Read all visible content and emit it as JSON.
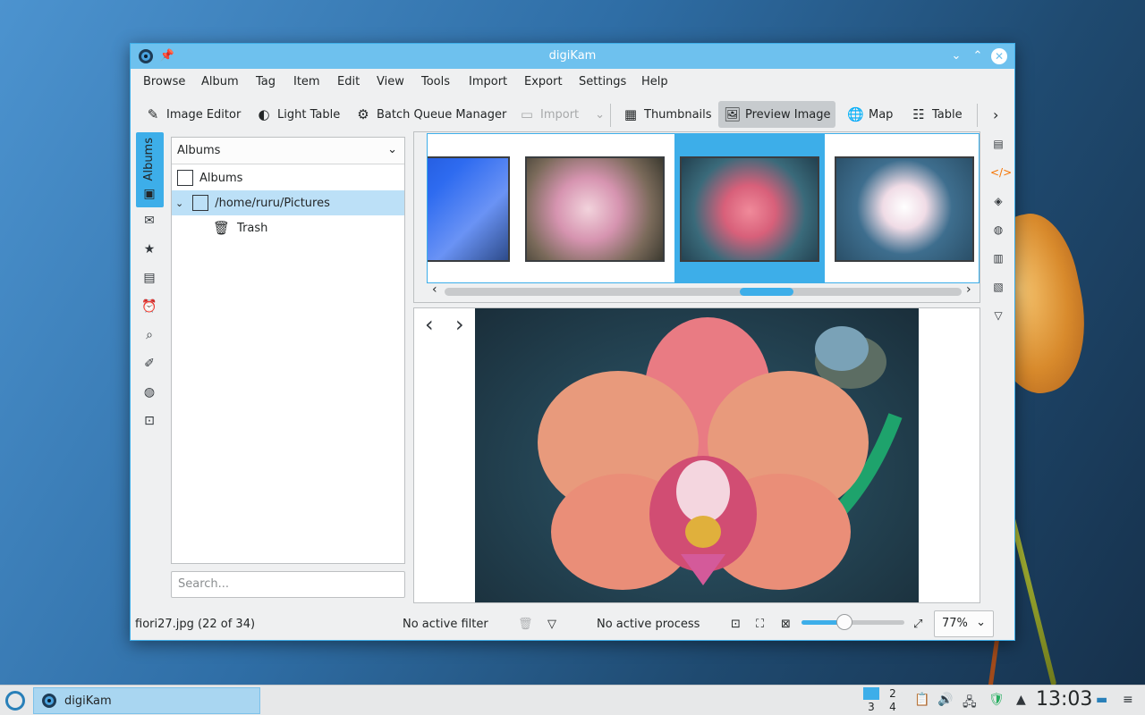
{
  "window": {
    "title": "digiKam",
    "minimize_icon": "chevron-down-icon",
    "maximize_icon": "chevron-up-icon",
    "close_icon": "close-icon"
  },
  "menubar": [
    "Browse",
    "Album",
    "Tag",
    "Item",
    "Edit",
    "View",
    "Tools",
    "Import",
    "Export",
    "Settings",
    "Help"
  ],
  "toolbar": {
    "image_editor": "Image Editor",
    "light_table": "Light Table",
    "batch_queue": "Batch Queue Manager",
    "import": "Import",
    "thumbnails": "Thumbnails",
    "preview_image": "Preview Image",
    "map": "Map",
    "table": "Table"
  },
  "sidebar": {
    "albums_tab": "Albums"
  },
  "albums_panel": {
    "header": "Albums",
    "tree": [
      {
        "label": "Albums"
      },
      {
        "label": "/home/ruru/Pictures",
        "selected": true
      },
      {
        "label": "Trash"
      }
    ],
    "search_placeholder": "Search..."
  },
  "status": {
    "file": "fiori27.jpg (22 of 34)",
    "filter": "No active filter",
    "process": "No active process",
    "zoom": "77%",
    "zoom_slider_fraction": 0.42
  },
  "taskbar": {
    "task_label": "digiKam",
    "pager": [
      "1",
      "2",
      "3",
      "4"
    ],
    "clock": "13:03"
  },
  "colors": {
    "accent": "#3daee9",
    "titlebar": "#6ec1ee",
    "window_bg": "#eff0f1"
  }
}
